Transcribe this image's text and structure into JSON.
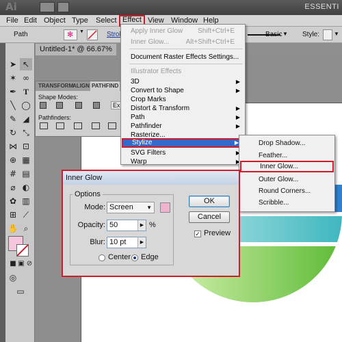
{
  "titlebar": {
    "app_logo": "Ai",
    "workspace": "ESSENTI"
  },
  "menubar": {
    "items": [
      "File",
      "Edit",
      "Object",
      "Type",
      "Select",
      "Effect",
      "View",
      "Window",
      "Help"
    ]
  },
  "control_bar": {
    "object_type": "Path",
    "stroke_label": "Strok",
    "style_preset": "Basic",
    "style_label": "Style:"
  },
  "document": {
    "tab_title": "Untitled-1* @ 66.67% (CMYK"
  },
  "panel": {
    "tabs": [
      "TRANSFORM",
      "ALIGN",
      "PATHFIND"
    ],
    "shape_modes_label": "Shape Modes:",
    "expand_label": "Ex",
    "pathfinders_label": "Pathfinders:"
  },
  "effect_menu": {
    "apply_last": {
      "label": "Apply Inner Glow",
      "shortcut": "Shift+Ctrl+E"
    },
    "last_effect": {
      "label": "Inner Glow...",
      "shortcut": "Alt+Shift+Ctrl+E"
    },
    "raster_settings": "Document Raster Effects Settings...",
    "section_header": "Illustrator Effects",
    "items": [
      "3D",
      "Convert to Shape",
      "Crop Marks",
      "Distort & Transform",
      "Path",
      "Pathfinder",
      "Rasterize...",
      "Stylize",
      "SVG Filters",
      "Warp"
    ]
  },
  "stylize_submenu": {
    "items": [
      "Drop Shadow...",
      "Feather...",
      "Inner Glow...",
      "Outer Glow...",
      "Round Corners...",
      "Scribble..."
    ]
  },
  "inner_glow_dialog": {
    "title": "Inner Glow",
    "options_label": "Options",
    "mode_label": "Mode:",
    "mode_value": "Screen",
    "glow_color": "#efb3cf",
    "opacity_label": "Opacity:",
    "opacity_value": "50",
    "opacity_unit": "%",
    "blur_label": "Blur:",
    "blur_value": "10 pt",
    "center_label": "Center",
    "edge_label": "Edge",
    "selected_source": "Edge",
    "ok_label": "OK",
    "cancel_label": "Cancel",
    "preview_label": "Preview",
    "preview_checked": true
  },
  "colors": {
    "highlight": "#3569c8",
    "callout": "#d11a2a"
  }
}
